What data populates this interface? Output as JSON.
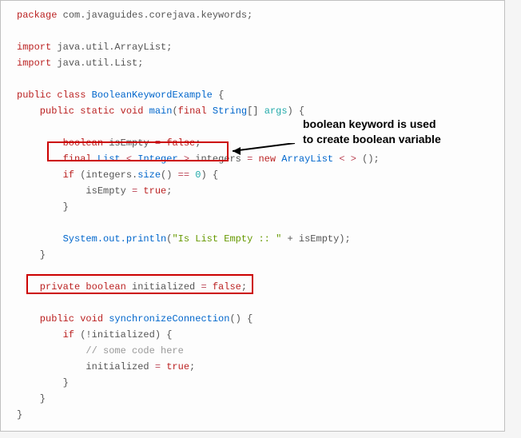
{
  "code": {
    "l1_a": "package",
    "l1_b": " com.javaguides.corejava.keywords;",
    "l3_a": "import",
    "l3_b": " java.util.ArrayList;",
    "l4_a": "import",
    "l4_b": " java.util.List;",
    "l6_a": "public",
    "l6_b": " class",
    "l6_c": " BooleanKeywordExample",
    "l6_d": " {",
    "l7_a": "    public",
    "l7_b": " static",
    "l7_c": " void",
    "l7_d": " main",
    "l7_e": "(",
    "l7_f": "final",
    "l7_g": " String",
    "l7_h": "[]",
    "l7_i": " args",
    "l7_j": ") {",
    "l9_a": "        boolean",
    "l9_b": " isEmpty ",
    "l9_c": "=",
    "l9_d": " false",
    "l9_e": ";",
    "l10_a": "        final",
    "l10_b": " List ",
    "l10_c": "<",
    "l10_d": " Integer ",
    "l10_e": ">",
    "l10_f": " integers ",
    "l10_g": "=",
    "l10_h": " new",
    "l10_i": " ArrayList ",
    "l10_j": "< >",
    "l10_k": " ();",
    "l11_a": "        if",
    "l11_b": " (integers.",
    "l11_c": "size",
    "l11_d": "() ",
    "l11_e": "==",
    "l11_f": " 0",
    "l11_g": ") {",
    "l12_a": "            isEmpty ",
    "l12_b": "=",
    "l12_c": " true",
    "l12_d": ";",
    "l13": "        }",
    "l15_a": "        System.out.",
    "l15_b": "println",
    "l15_c": "(",
    "l15_d": "\"Is List Empty :: \"",
    "l15_e": " + isEmpty);",
    "l16": "    }",
    "l18_a": "    private",
    "l18_b": " boolean",
    "l18_c": " initialized ",
    "l18_d": "=",
    "l18_e": " false",
    "l18_f": ";",
    "l20_a": "    public",
    "l20_b": " void",
    "l20_c": " synchronizeConnection",
    "l20_d": "() {",
    "l21_a": "        if",
    "l21_b": " (!initialized) {",
    "l22": "            // some code here",
    "l23_a": "            initialized ",
    "l23_b": "=",
    "l23_c": " true",
    "l23_d": ";",
    "l24": "        }",
    "l25": "    }",
    "l26": "}"
  },
  "annotation": {
    "line1": "boolean keyword is used",
    "line2": "to create boolean variable"
  }
}
